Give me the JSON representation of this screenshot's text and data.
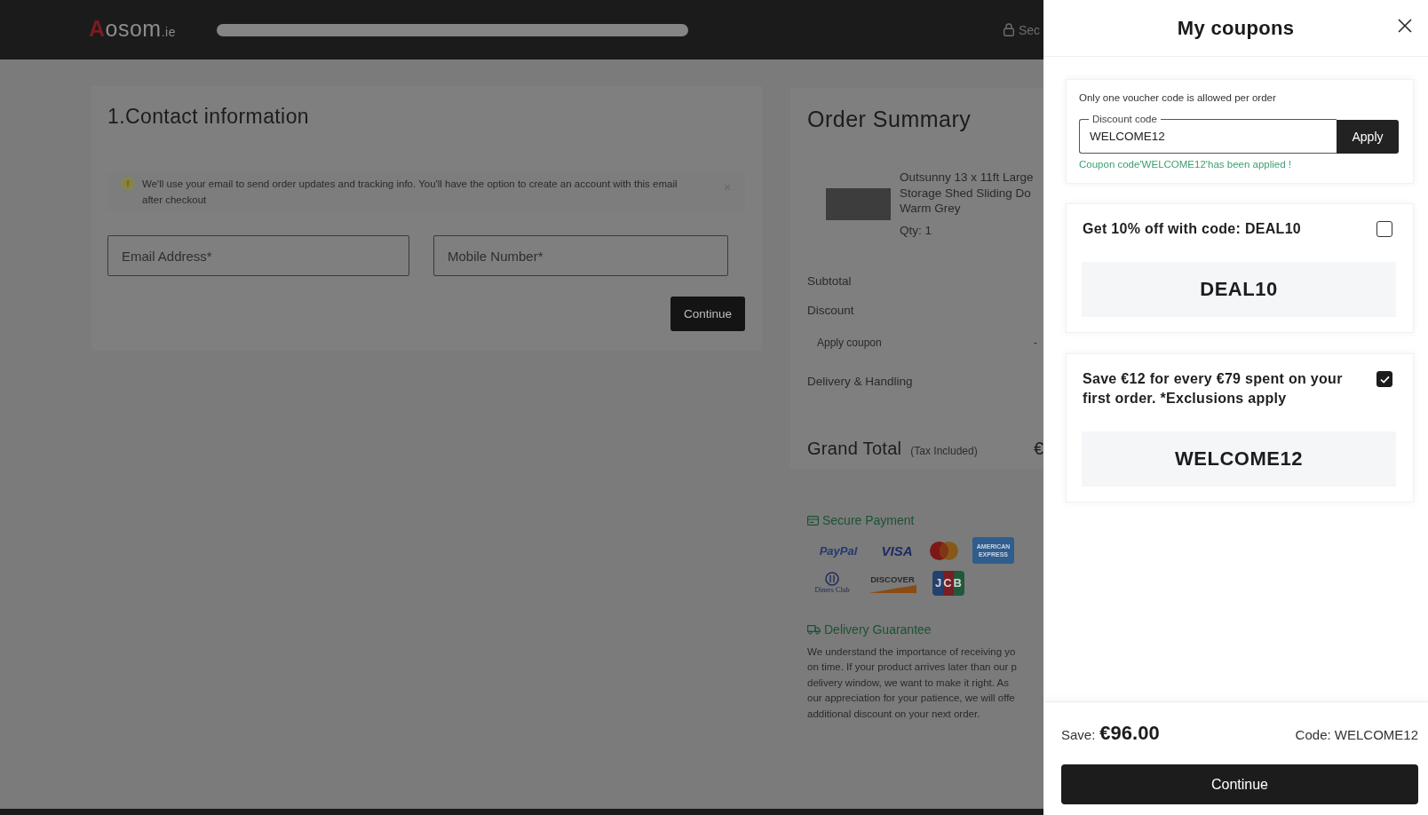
{
  "header": {
    "logo": {
      "initial": "A",
      "rest": "osom",
      "suffix": ".ie"
    },
    "secure_label": "Sec"
  },
  "contact": {
    "title": "1.Contact information",
    "notice": "We'll use your email to send order updates and tracking info. You'll have the option to create an account with this email after checkout",
    "fields": [
      {
        "placeholder": "Email Address*"
      },
      {
        "placeholder": "Mobile Number*"
      }
    ],
    "button": "Continue"
  },
  "summary": {
    "title": "Order Summary",
    "product": {
      "title": "Outsunny 13 x 11ft Large\nStorage Shed Sliding Do\nWarm Grey",
      "quantity": "Qty: 1"
    },
    "rows": [
      {
        "kind": "line",
        "label": "Subtotal"
      },
      {
        "kind": "line",
        "label": "Discount"
      },
      {
        "kind": "sub",
        "label": "Apply coupon",
        "value": "-"
      },
      {
        "kind": "line",
        "label": "Delivery & Handling"
      }
    ],
    "total": {
      "label": "Grand Total",
      "note": "(Tax Included)",
      "value": "€"
    }
  },
  "secure_payment": {
    "title": "Secure Payment",
    "methods": [
      {
        "kind": "paypal",
        "label": "PayPal"
      },
      {
        "kind": "visa",
        "label": "VISA"
      },
      {
        "kind": "mastercard"
      },
      {
        "kind": "amex",
        "label": "AMERICAN EXPRESS"
      },
      {
        "kind": "diners",
        "label": "Diners Club"
      },
      {
        "kind": "discover",
        "label": "DISCOVER"
      },
      {
        "kind": "jcb",
        "label": "JCB"
      }
    ]
  },
  "delivery_guarantee": {
    "title": "Delivery Guarantee",
    "text": "We understand the importance of receiving yo\non time. If your product arrives later than our p\ndelivery window, we want to make it right. As\nour appreciation for your patience, we will offe\nadditional discount on your next order."
  },
  "coupons_panel": {
    "title": "My coupons",
    "voucher": {
      "note": "Only one voucher code is allowed per order",
      "field_label": "Discount code",
      "value": "WELCOME12",
      "button": "Apply",
      "message": "Coupon code'WELCOME12'has been applied !"
    },
    "coupons": [
      {
        "title": "Get 10% off with code: DEAL10",
        "code": "DEAL10",
        "checked": false
      },
      {
        "title": "Save €12 for every €79 spent on your first order. *Exclusions apply",
        "code": "WELCOME12",
        "checked": true
      }
    ],
    "footer": {
      "save_label": "Save:",
      "save_value": "€96.00",
      "code_label": "Code: WELCOME12",
      "button": "Continue"
    }
  }
}
